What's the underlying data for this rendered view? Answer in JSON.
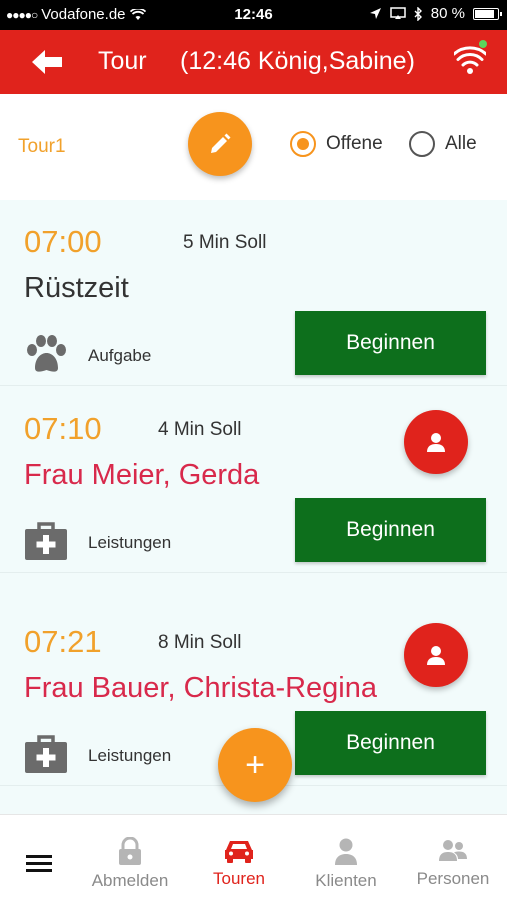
{
  "status_bar": {
    "carrier": "Vodafone.de",
    "time": "12:46",
    "battery": "80 %",
    "battery_level": 0.8
  },
  "header": {
    "title": "Tour",
    "subtitle": "(12:46 König,Sabine)",
    "back_icon": "arrow-left-icon",
    "connection_icon": "wifi-icon",
    "connection_status_color": "#5cd65c"
  },
  "filter": {
    "tour_name": "Tour1",
    "edit_icon": "pencil-icon",
    "options": [
      {
        "label": "Offene",
        "selected": true
      },
      {
        "label": "Alle",
        "selected": false
      }
    ]
  },
  "entries": [
    {
      "time": "07:00",
      "soll": "5 Min Soll",
      "name": "Rüstzeit",
      "kind": "task",
      "type_label": "Aufgabe",
      "type_icon": "paw-icon",
      "action": "Beginnen",
      "has_client": false
    },
    {
      "time": "07:10",
      "soll": "4 Min Soll",
      "name": "Frau Meier, Gerda",
      "kind": "client",
      "type_label": "Leistungen",
      "type_icon": "medical-kit-icon",
      "action": "Beginnen",
      "has_client": true
    },
    {
      "time": "07:21",
      "soll": "8 Min Soll",
      "name": "Frau Bauer, Christa-Regina",
      "kind": "client",
      "type_label": "Leistungen",
      "type_icon": "medical-kit-icon",
      "action": "Beginnen",
      "has_client": true
    }
  ],
  "fab": {
    "label": "+"
  },
  "bottom_nav": [
    {
      "label": "Abmelden",
      "icon": "lock-icon",
      "active": false
    },
    {
      "label": "Touren",
      "icon": "car-icon",
      "active": true
    },
    {
      "label": "Klienten",
      "icon": "person-icon",
      "active": false
    },
    {
      "label": "Personen",
      "icon": "people-icon",
      "active": false
    }
  ],
  "colors": {
    "primary": "#e0231c",
    "accent": "#f7941d",
    "time": "#f1a12b",
    "client_name": "#d8294b",
    "begin_button": "#0d6f1c",
    "list_background": "#f2fbfb"
  }
}
